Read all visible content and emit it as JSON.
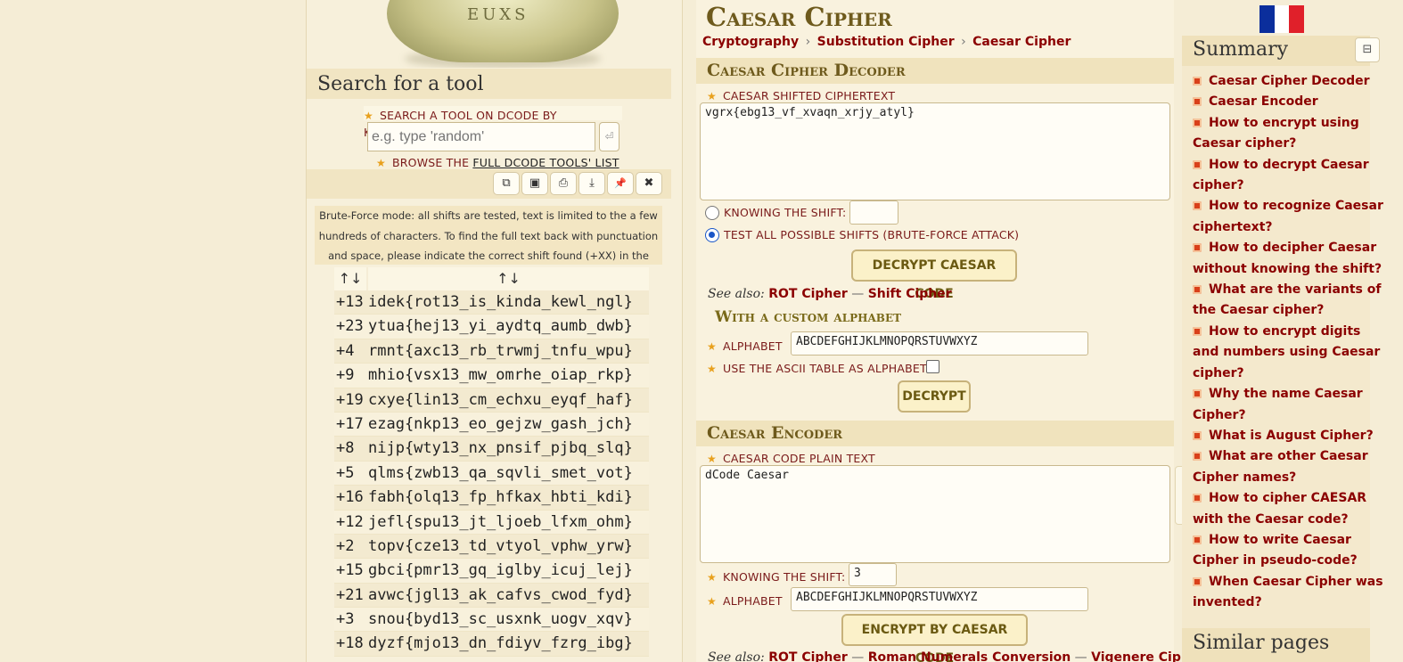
{
  "logo": {
    "letters": "EUXS"
  },
  "search": {
    "title": "Search for a tool",
    "keywords_label": "SEARCH A TOOL ON DCODE BY KEYWORDS:",
    "placeholder": "e.g. type 'random'",
    "browse_prefix": "BROWSE THE ",
    "browse_link": "FULL DCODE TOOLS' LIST"
  },
  "toolbar": {
    "icons": [
      "copy-icon",
      "screenshot-icon",
      "print-icon",
      "download-icon",
      "pin-icon",
      "close-icon"
    ],
    "glyphs": [
      "⧉",
      "▣",
      "⎙",
      "⤓",
      "📌",
      "✖"
    ]
  },
  "bruteforce": {
    "note": "Brute-Force mode: all shifts are tested, text is limited to the a few hundreds of characters. To find the full text back with punctuation and space, please indicate the correct shift found (+XX) in the form.",
    "col_shift_sort": "↑↓",
    "col_text_sort": "↑↓",
    "rows": [
      {
        "shift": "+13",
        "text": "idek{rot13_is_kinda_kewl_ngl}"
      },
      {
        "shift": "+23",
        "text": "ytua{hej13_yi_aydtq_aumb_dwb}"
      },
      {
        "shift": "+4",
        "text": "rmnt{axc13_rb_trwmj_tnfu_wpu}"
      },
      {
        "shift": "+9",
        "text": "mhio{vsx13_mw_omrhe_oiap_rkp}"
      },
      {
        "shift": "+19",
        "text": "cxye{lin13_cm_echxu_eyqf_haf}"
      },
      {
        "shift": "+17",
        "text": "ezag{nkp13_eo_gejzw_gash_jch}"
      },
      {
        "shift": "+8",
        "text": "nijp{wty13_nx_pnsif_pjbq_slq}"
      },
      {
        "shift": "+5",
        "text": "qlms{zwb13_qa_sqvli_smet_vot}"
      },
      {
        "shift": "+16",
        "text": "fabh{olq13_fp_hfkax_hbti_kdi}"
      },
      {
        "shift": "+12",
        "text": "jefl{spu13_jt_ljoeb_lfxm_ohm}"
      },
      {
        "shift": "+2",
        "text": "topv{cze13_td_vtyol_vphw_yrw}"
      },
      {
        "shift": "+15",
        "text": "gbci{pmr13_gq_iglby_icuj_lej}"
      },
      {
        "shift": "+21",
        "text": "avwc{jgl13_ak_cafvs_cwod_fyd}"
      },
      {
        "shift": "+3",
        "text": "snou{byd13_sc_usxnk_uogv_xqv}"
      },
      {
        "shift": "+18",
        "text": "dyzf{mjo13_dn_fdiyv_fzrg_ibg}"
      }
    ]
  },
  "page": {
    "title": "Caesar Cipher",
    "breadcrumb": [
      "Cryptography",
      "Substitution Cipher",
      "Caesar Cipher"
    ],
    "breadcrumb_sep": "›"
  },
  "decoder": {
    "heading": "Caesar Cipher Decoder",
    "ciphertext_label": "CAESAR SHIFTED CIPHERTEXT",
    "ciphertext_value": "vgrx{ebg13_vf_xvaqn_xrjy_atyl}",
    "knowing_shift_label": "KNOWING THE SHIFT:",
    "knowing_shift_value": "",
    "bruteforce_label": "TEST ALL POSSIBLE SHIFTS (BRUTE-FORCE ATTACK)",
    "button": "DECRYPT CAESAR CODE",
    "see_also_label": "See also:",
    "see_also_links": [
      "ROT Cipher",
      "Shift Cipher"
    ],
    "see_also_sep": "—",
    "custom_heading": "With a custom alphabet",
    "alphabet_label": "ALPHABET",
    "alphabet_value": "ABCDEFGHIJKLMNOPQRSTUVWXYZ",
    "ascii_label": "USE THE ASCII TABLE AS ALPHABET",
    "decrypt_button": "DECRYPT"
  },
  "encoder": {
    "heading": "Caesar Encoder",
    "plaintext_label": "CAESAR CODE PLAIN TEXT",
    "plaintext_value": "dCode Caesar",
    "shift_label": "KNOWING THE SHIFT:",
    "shift_value": "3",
    "alphabet_label": "ALPHABET",
    "alphabet_value": "ABCDEFGHIJKLMNOPQRSTUVWXYZ",
    "button": "ENCRYPT BY CAESAR CODE",
    "see_also_label": "See also:",
    "see_also_links": [
      "ROT Cipher",
      "Roman Numerals Conversion",
      "Vigenere Cipher"
    ]
  },
  "summary": {
    "title": "Summary",
    "items": [
      "Caesar Cipher Decoder",
      "Caesar Encoder",
      "How to encrypt using Caesar cipher?",
      "How to decrypt Caesar cipher?",
      "How to recognize Caesar ciphertext?",
      "How to decipher Caesar without knowing the shift?",
      "What are the variants of the Caesar cipher?",
      "How to encrypt digits and numbers using Caesar cipher?",
      "Why the name Caesar Cipher?",
      "What is August Cipher?",
      "What are other Caesar Cipher names?",
      "How to cipher CAESAR with the Caesar code?",
      "How to write Caesar Cipher in pseudo-code?",
      "When Caesar Cipher was invented?"
    ],
    "similar_title": "Similar pages"
  },
  "colors": {
    "link": "#8b0000",
    "accent": "#6e5a1c",
    "radio_on": "#1a56c7",
    "flag": [
      "#0b2e9c",
      "#ffffff",
      "#e0202a"
    ]
  }
}
